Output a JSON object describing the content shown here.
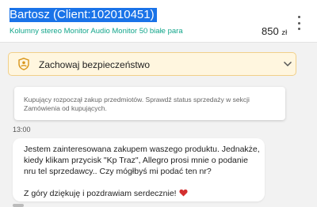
{
  "header": {
    "title": "Bartosz (Client:102010451)",
    "subtitle": "Kolumny stereo Monitor Audio Monitor 50 białe para",
    "price": "850",
    "currency": "zł"
  },
  "safety_banner": {
    "label": "Zachowaj bezpieczeństwo",
    "icon": "shield-person-icon",
    "accent_bg": "#fff6df",
    "accent_border": "#f1d08a"
  },
  "system_message": {
    "text": "Kupujący rozpoczął zakup przedmiotów. Sprawdź status sprzedaży w sekcji Zamówienia od kupujących."
  },
  "conversation": {
    "timestamp": "13:00",
    "message_paragraph_1": "Jestem zainteresowana zakupem waszego produktu. Jednakże, kiedy klikam przycisk \"Kp Traz\", Allegro prosi mnie o podanie nru tel sprzedawcy.. Czy mógłbyś mi podać ten nr?",
    "message_paragraph_2": "Z góry dziękuję i pozdrawiam serdecznie!"
  },
  "colors": {
    "selection": "#1a73e8",
    "subtitle_link": "#11a58a",
    "heart": "#d32f2f"
  }
}
